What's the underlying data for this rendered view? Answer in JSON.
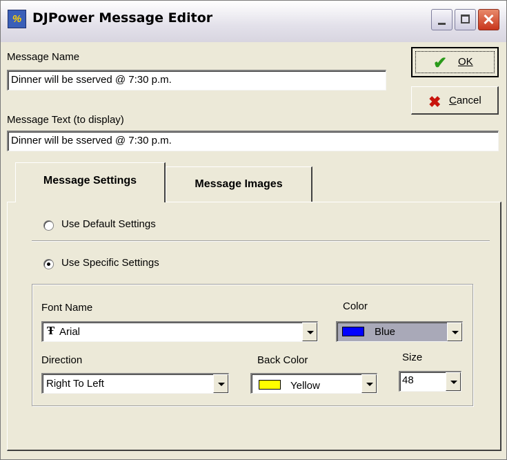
{
  "window": {
    "title": "DJPower Message Editor",
    "app_icon_text": "%"
  },
  "title_buttons": {
    "close_glyph": "✕"
  },
  "form": {
    "message_name_label": "Message Name",
    "message_name_value": "Dinner will be sserved @ 7:30 p.m.",
    "message_text_label": "Message Text (to display)",
    "message_text_value": "Dinner will be sserved @ 7:30 p.m."
  },
  "buttons": {
    "ok_label": "OK",
    "ok_icon": "check-icon",
    "cancel_label": "Cancel",
    "cancel_icon": "x-icon"
  },
  "tabs": [
    {
      "label": "Message Settings",
      "active": true
    },
    {
      "label": "Message Images",
      "active": false
    }
  ],
  "settings": {
    "default_option_label": "Use Default Settings",
    "specific_option_label": "Use Specific Settings",
    "selected_option": "specific",
    "font_name_label": "Font Name",
    "font_name_value": "Arial",
    "color_label": "Color",
    "color_value": "Blue",
    "color_swatch": "#0000ff",
    "direction_label": "Direction",
    "direction_value": "Right To Left",
    "back_color_label": "Back Color",
    "back_color_value": "Yellow",
    "back_color_swatch": "#ffff00",
    "size_label": "Size",
    "size_value": "48"
  },
  "colors": {
    "dialog_background": "#ece9d8",
    "ok_check": "#2a9a1a",
    "cancel_x": "#c8140c"
  }
}
